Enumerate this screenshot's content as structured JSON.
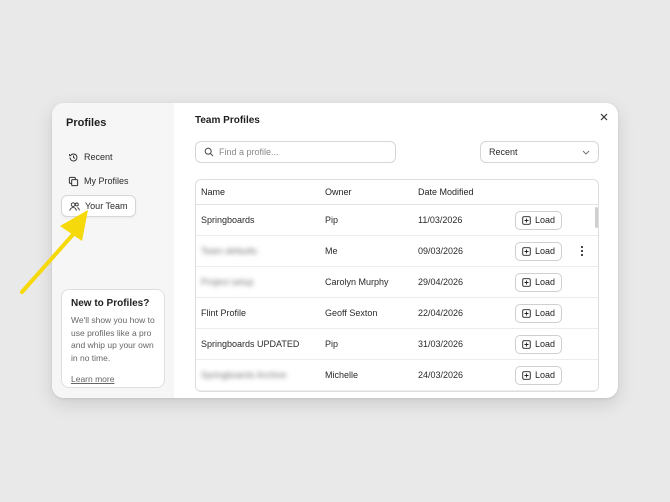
{
  "sidebar": {
    "title": "Profiles",
    "items": [
      {
        "label": "Recent",
        "icon": "history-icon",
        "active": false
      },
      {
        "label": "My Profiles",
        "icon": "copy-icon",
        "active": false
      },
      {
        "label": "Your Team",
        "icon": "users-icon",
        "active": true
      }
    ],
    "promo": {
      "title": "New to Profiles?",
      "text": "We'll show you how to use profiles like a pro and whip up your own in no time.",
      "link": "Learn more"
    }
  },
  "main": {
    "title": "Team Profiles",
    "search": {
      "placeholder": "Find a profile...",
      "value": ""
    },
    "sort": {
      "selected": "Recent"
    },
    "table": {
      "headers": [
        "Name",
        "Owner",
        "Date Modified"
      ],
      "action_label": "Load",
      "rows": [
        {
          "name": "Springboards",
          "owner": "Pip",
          "date": "11/03/2026",
          "blurred": false
        },
        {
          "name": "Team defaults",
          "owner": "Me",
          "date": "09/03/2026",
          "blurred": true
        },
        {
          "name": "Project setup",
          "owner": "Carolyn Murphy",
          "date": "29/04/2026",
          "blurred": true
        },
        {
          "name": "Flint Profile",
          "owner": "Geoff Sexton",
          "date": "22/04/2026",
          "blurred": false
        },
        {
          "name": "Springboards UPDATED",
          "owner": "Pip",
          "date": "31/03/2026",
          "blurred": false
        },
        {
          "name": "Springboards Archive",
          "owner": "Michelle",
          "date": "24/03/2026",
          "blurred": true
        }
      ]
    }
  },
  "colors": {
    "annotation_arrow": "#f5d90a",
    "background": "#e9e9e9"
  }
}
